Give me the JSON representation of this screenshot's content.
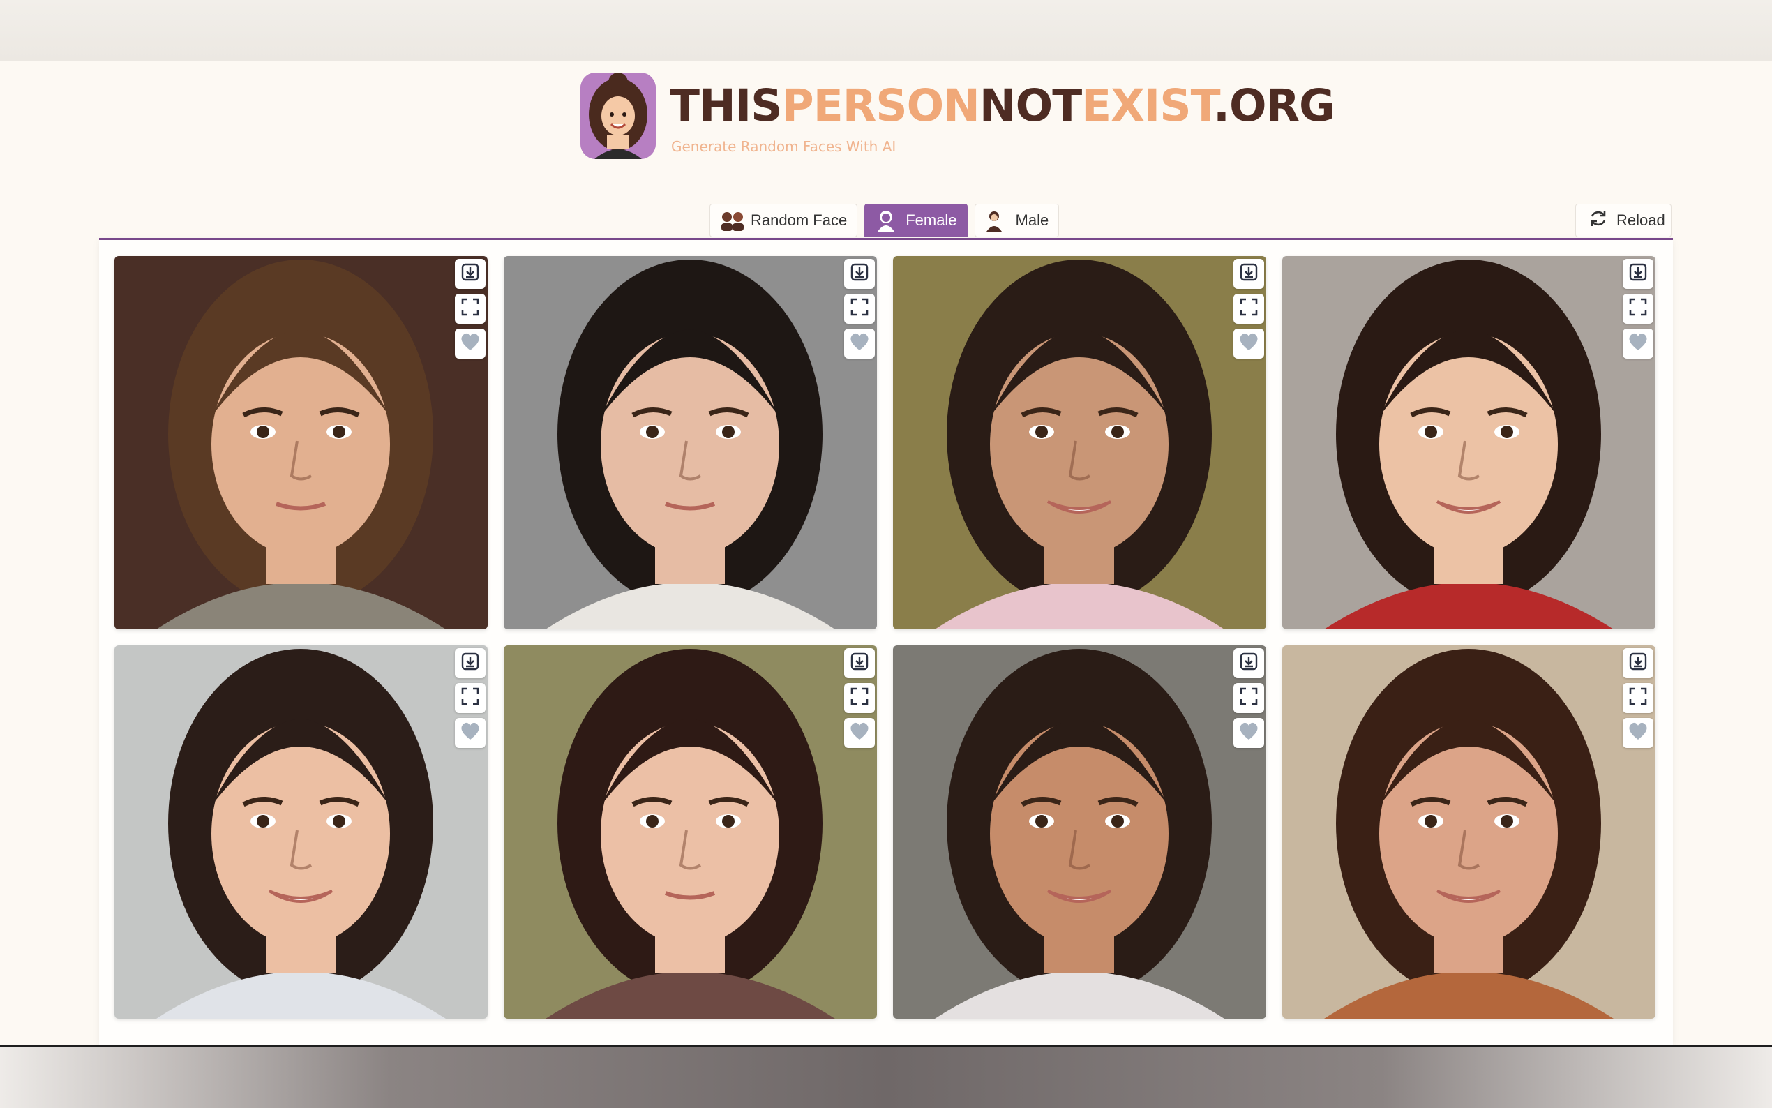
{
  "site": {
    "title_parts": [
      "THIS",
      "PERSON",
      "NOT",
      "EXIST",
      ".ORG"
    ],
    "tagline": "Generate Random Faces With AI"
  },
  "tabs": [
    {
      "label": "Random Face",
      "icon": "two-people-icon",
      "active": false
    },
    {
      "label": "Female",
      "icon": "female-icon",
      "active": true
    },
    {
      "label": "Male",
      "icon": "male-icon",
      "active": false
    }
  ],
  "reload": {
    "label": "Reload",
    "icon": "refresh-icon"
  },
  "faces": [
    {
      "bg": "#4a2f26",
      "skin": "#e2b090",
      "hair": "#5a3a24",
      "shirt": "#8a8478",
      "smile": false,
      "image": "face-photo-woman"
    },
    {
      "bg": "#8f8f8f",
      "skin": "#e6bca4",
      "hair": "#1e1714",
      "shirt": "#e9e6e1",
      "smile": false,
      "image": "face-photo-woman"
    },
    {
      "bg": "#8a7e4a",
      "skin": "#c99676",
      "hair": "#2a1c16",
      "shirt": "#e8c4cc",
      "smile": true,
      "image": "face-photo-woman"
    },
    {
      "bg": "#aaa39d",
      "skin": "#ecc2a5",
      "hair": "#2a1a14",
      "shirt": "#b72a2a",
      "smile": true,
      "image": "face-photo-woman"
    },
    {
      "bg": "#c4c6c5",
      "skin": "#ecbfa3",
      "hair": "#2b1d18",
      "shirt": "#e0e3e8",
      "smile": true,
      "image": "face-photo-woman"
    },
    {
      "bg": "#8f8b60",
      "skin": "#ecc0a6",
      "hair": "#2e1a15",
      "shirt": "#6e4a44",
      "smile": false,
      "image": "face-photo-woman"
    },
    {
      "bg": "#7c7a74",
      "skin": "#c68c6a",
      "hair": "#2a1c16",
      "shirt": "#e4e0e0",
      "smile": true,
      "image": "face-photo-woman"
    },
    {
      "bg": "#c8b79f",
      "skin": "#dca488",
      "hair": "#3a2015",
      "shirt": "#b4673c",
      "smile": true,
      "image": "face-photo-woman"
    }
  ],
  "card_actions": [
    "download-icon",
    "fullscreen-icon",
    "heart-icon"
  ]
}
